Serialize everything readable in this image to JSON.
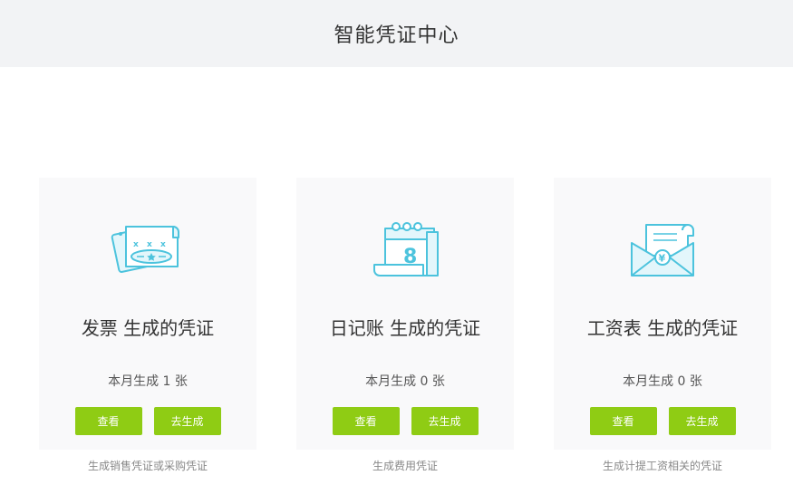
{
  "header": {
    "title": "智能凭证中心"
  },
  "accent_color": "#8fcc14",
  "icon_color": "#4cc3dd",
  "cards": [
    {
      "icon": "invoice-icon",
      "title": "发票 生成的凭证",
      "count_text": "本月生成 1 张",
      "view_label": "查看",
      "generate_label": "去生成",
      "description": "生成销售凭证或采购凭证"
    },
    {
      "icon": "journal-calendar-icon",
      "title": "日记账 生成的凭证",
      "count_text": "本月生成 0 张",
      "view_label": "查看",
      "generate_label": "去生成",
      "description": "生成费用凭证"
    },
    {
      "icon": "salary-envelope-icon",
      "title": "工资表 生成的凭证",
      "count_text": "本月生成 0 张",
      "view_label": "查看",
      "generate_label": "去生成",
      "description": "生成计提工资相关的凭证"
    }
  ]
}
